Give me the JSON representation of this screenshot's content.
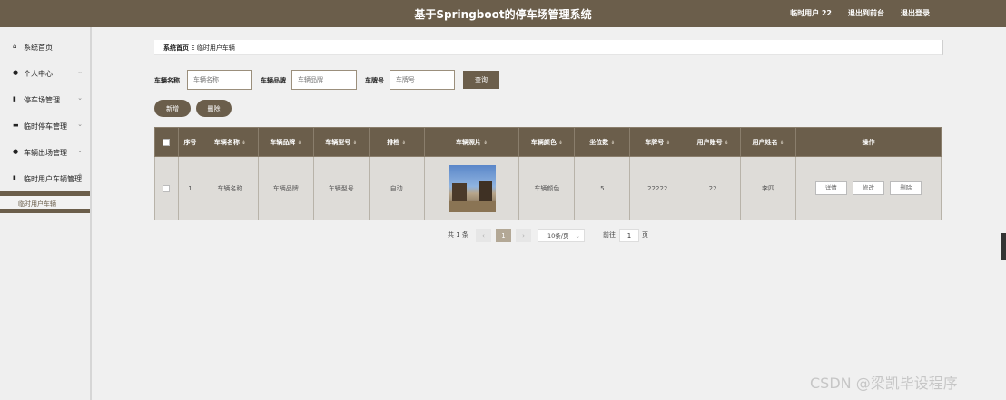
{
  "header": {
    "title": "基于Springboot的停车场管理系统",
    "user_label": "临时用户 22",
    "to_frontend": "退出到前台",
    "logout": "退出登录"
  },
  "sidebar": {
    "items": [
      {
        "label": "系统首页",
        "icon": "home-icon",
        "glyph": "⌂",
        "has_arrow": false
      },
      {
        "label": "个人中心",
        "icon": "user-icon",
        "glyph": "●",
        "has_arrow": true,
        "arrow": "⌄"
      },
      {
        "label": "停车场管理",
        "icon": "book-icon",
        "glyph": "▮",
        "has_arrow": true,
        "arrow": "⌄"
      },
      {
        "label": "临时停车管理",
        "icon": "monitor-icon",
        "glyph": "▬",
        "has_arrow": true,
        "arrow": "⌄"
      },
      {
        "label": "车辆出场管理",
        "icon": "user-icon",
        "glyph": "●",
        "has_arrow": true,
        "arrow": "⌄"
      },
      {
        "label": "临时用户车辆管理",
        "icon": "bar-chart-icon",
        "glyph": "▮",
        "has_arrow": true,
        "arrow": "^"
      }
    ],
    "sub_item": "临时用户车辆"
  },
  "breadcrumb": {
    "home": "系统首页",
    "separator": "Ξ",
    "current": "临时用户车辆"
  },
  "search": {
    "fields": [
      {
        "label": "车辆名称",
        "placeholder": "车辆名称"
      },
      {
        "label": "车辆品牌",
        "placeholder": "车辆品牌"
      },
      {
        "label": "车牌号",
        "placeholder": "车牌号"
      }
    ],
    "query_button": "查询"
  },
  "actions": {
    "add": "新增",
    "delete": "删除"
  },
  "table": {
    "columns": [
      "序号",
      "车辆名称",
      "车辆品牌",
      "车辆型号",
      "排档",
      "车辆照片",
      "车辆颜色",
      "坐位数",
      "车牌号",
      "用户账号",
      "用户姓名",
      "操作"
    ],
    "sort_glyph": "⇕",
    "rows": [
      {
        "index": "1",
        "name": "车辆名称",
        "brand": "车辆品牌",
        "model": "车辆型号",
        "gear": "自动",
        "color": "车辆颜色",
        "seats": "5",
        "plate": "22222",
        "account": "22",
        "username": "李四"
      }
    ],
    "row_actions": {
      "detail": "详情",
      "edit": "修改",
      "delete": "删除"
    }
  },
  "pagination": {
    "total": "共 1 条",
    "prev": "‹",
    "current_page": "1",
    "next": "›",
    "page_size": "10条/页",
    "jump_prefix": "前往",
    "jump_value": "1",
    "jump_suffix": "页"
  },
  "watermark": "CSDN @梁凯毕设程序",
  "colors": {
    "accent": "#6b5e4b",
    "background": "#f0f0f0"
  }
}
